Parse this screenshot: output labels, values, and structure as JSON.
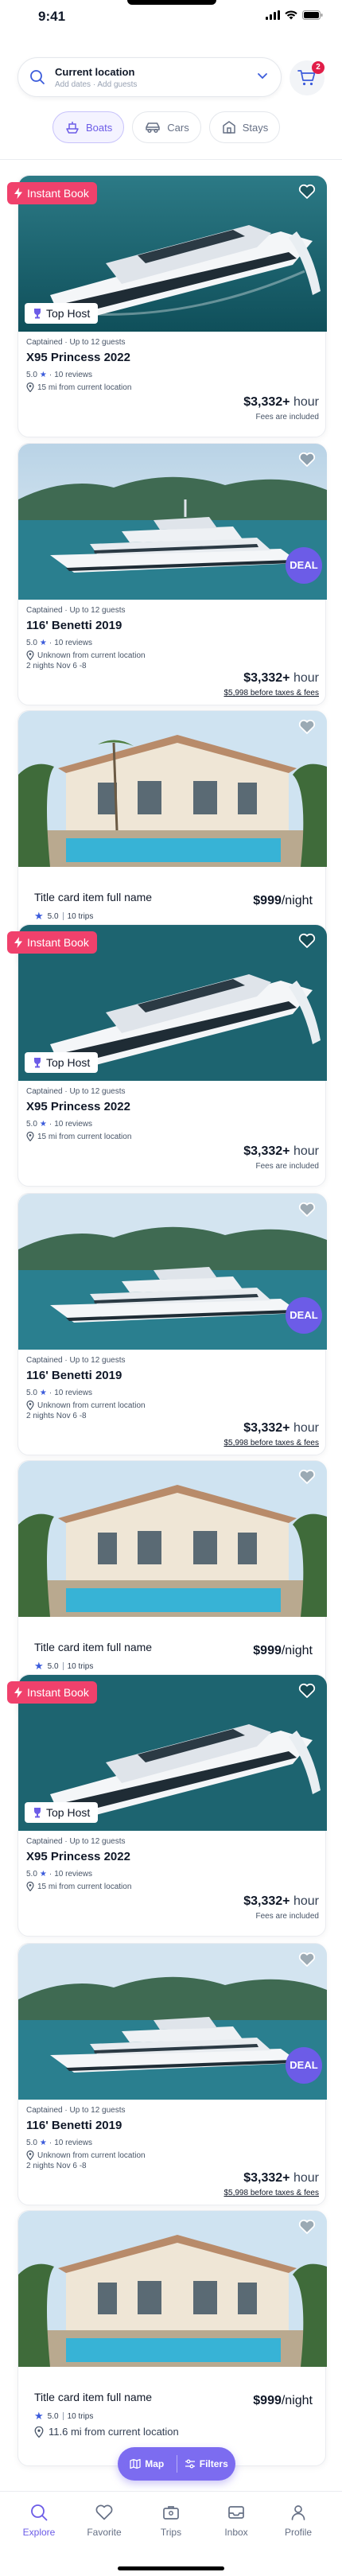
{
  "status_bar": {
    "time": "9:41"
  },
  "search": {
    "title": "Current location",
    "subtitle": "Add dates · Add guests",
    "cart_count": "2"
  },
  "categories": [
    {
      "label": "Boats",
      "active": true
    },
    {
      "label": "Cars",
      "active": false
    },
    {
      "label": "Stays",
      "active": false
    }
  ],
  "listings": {
    "princess": {
      "instant_label": "Instant Book",
      "top_host_label": "Top Host",
      "meta": "Captained · Up to 12 guests",
      "title": "X95 Princess 2022",
      "rating": "5.0",
      "reviews": "10 reviews",
      "location": "15 mi from current location",
      "price": "$3,332+",
      "price_unit": "hour",
      "price_note": "Fees are included"
    },
    "benetti": {
      "deal_label": "DEAL",
      "meta": "Captained · Up to 12 guests",
      "title": "116' Benetti 2019",
      "rating": "5.0",
      "reviews": "10 reviews",
      "location": "Unknown from current location",
      "dates": "2 nights Nov 6 -8",
      "price": "$3,332+",
      "price_unit": "hour",
      "price_note": "$5,998 before taxes & fees"
    },
    "home": {
      "title": "Title card item full name",
      "rating": "5.0",
      "trips": "10 trips",
      "location": "11.6 mi from current location",
      "price": "$999",
      "price_unit": "/night"
    }
  },
  "map_filter": {
    "map_label": "Map",
    "filters_label": "Filters"
  },
  "bottom_nav": [
    {
      "label": "Explore",
      "icon": "search-icon",
      "active": true
    },
    {
      "label": "Favorite",
      "icon": "heart-icon",
      "active": false
    },
    {
      "label": "Trips",
      "icon": "briefcase-icon",
      "active": false
    },
    {
      "label": "Inbox",
      "icon": "inbox-icon",
      "active": false
    },
    {
      "label": "Profile",
      "icon": "user-icon",
      "active": false
    }
  ],
  "colors": {
    "accent": "#6c5ce7",
    "instant_badge": "#f0416c",
    "deal_badge": "#6c5ce7",
    "cart_badge": "#e11d48"
  }
}
